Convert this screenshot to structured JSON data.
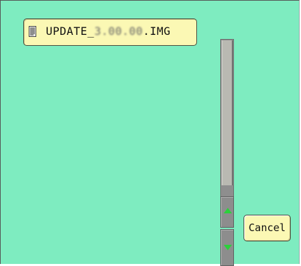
{
  "file_list": {
    "items": [
      {
        "name_prefix": "UPDATE_",
        "name_obscured": "3.00.00",
        "name_suffix": ".IMG",
        "icon": "document-icon"
      }
    ]
  },
  "scrollbar": {
    "up_icon": "up-arrow-icon",
    "down_icon": "down-arrow-icon",
    "arrow_color": "#2bd13a"
  },
  "buttons": {
    "cancel_label": "Cancel"
  },
  "colors": {
    "background": "#7eecc0",
    "item_fill": "#fbf8b4"
  }
}
